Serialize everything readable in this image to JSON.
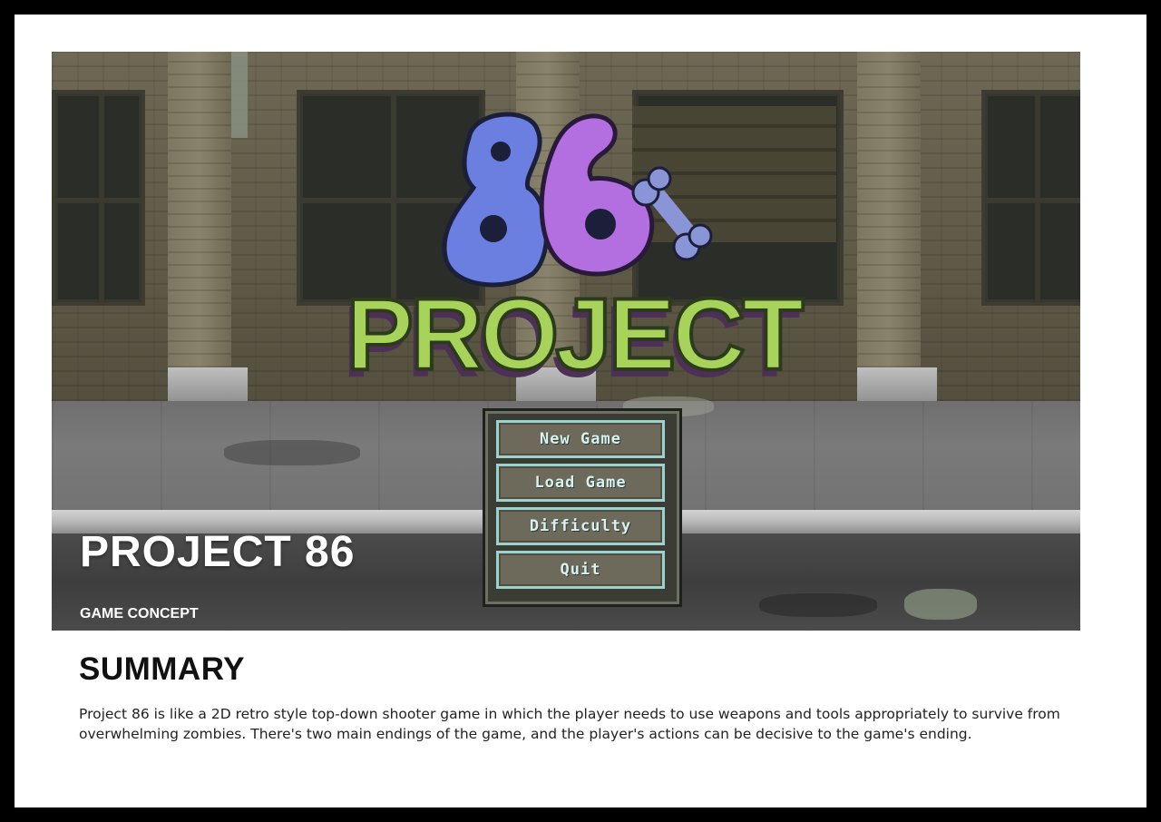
{
  "hero": {
    "title": "PROJECT 86",
    "subtitle": "GAME CONCEPT"
  },
  "game_logo": {
    "number": "86",
    "word": "PROJECT",
    "colors": {
      "eight": "#6a7fe0",
      "six": "#b36ee0",
      "bone": "#8a95d8",
      "letters": "#a8d35a",
      "letter_shadow": "#4e2f57"
    }
  },
  "menu": {
    "items": [
      {
        "label": "New Game"
      },
      {
        "label": "Load Game"
      },
      {
        "label": "Difficulty"
      },
      {
        "label": "Quit"
      }
    ],
    "colors": {
      "button_fill": "#6e6a5b",
      "button_border": "#9ad3cc",
      "text": "#d9f2ef"
    }
  },
  "summary": {
    "heading": "SUMMARY",
    "body": "Project 86 is like a 2D retro style top-down shooter game in which the player needs to use weapons and tools appropriately to survive from overwhelming zombies. There's two main endings of the game, and the player's actions can be decisive to the game's ending."
  }
}
